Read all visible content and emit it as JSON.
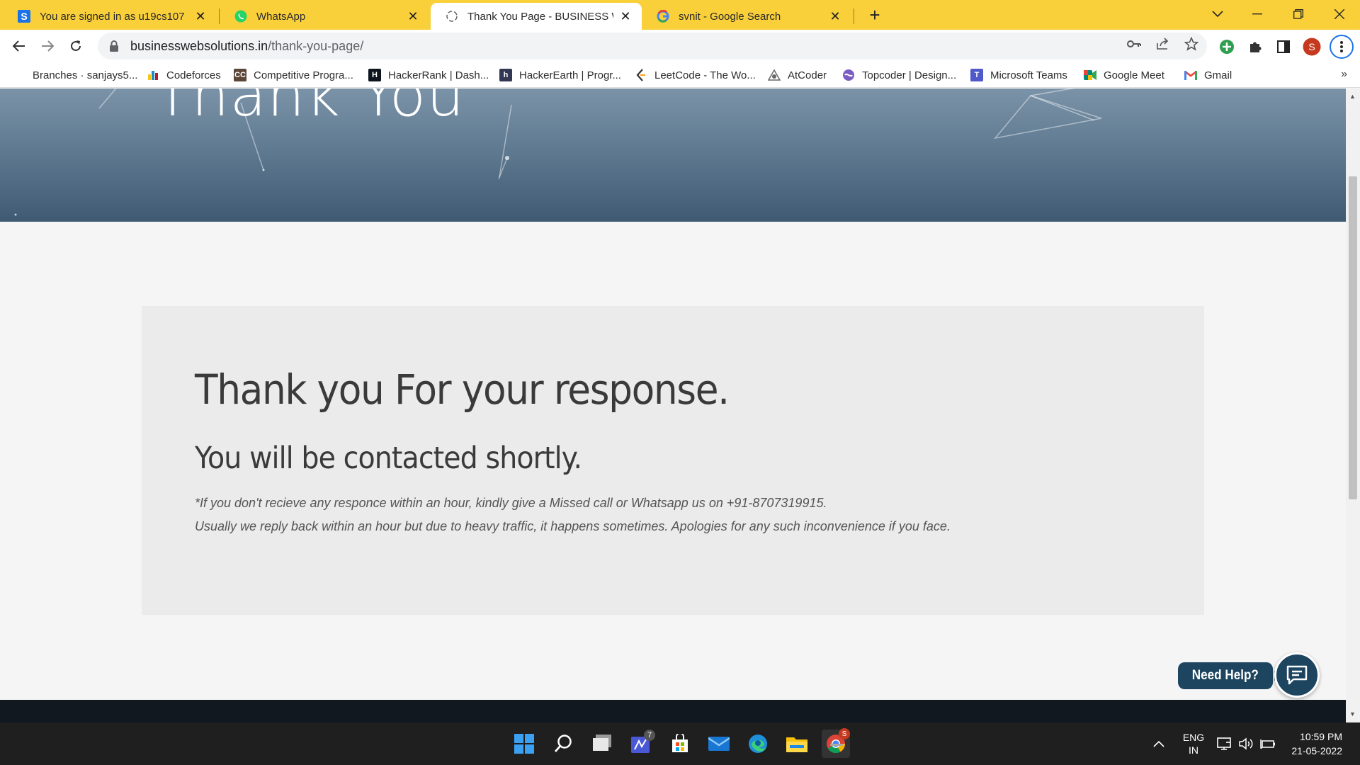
{
  "tabs": [
    {
      "title": "You are signed in as u19cs107",
      "favicon": "s-box-icon",
      "color": "#1a73e8"
    },
    {
      "title": "WhatsApp",
      "favicon": "whatsapp-icon",
      "color": "#25d366"
    },
    {
      "title": "Thank You Page - BUSINESS WEB",
      "favicon": "site-swirl-icon",
      "color": "#5f6368"
    },
    {
      "title": "svnit - Google Search",
      "favicon": "google-g-icon",
      "color": "#4285f4"
    }
  ],
  "address": {
    "host": "businesswebsolutions.in",
    "path": "/thank-you-page/"
  },
  "profile_initial": "S",
  "bookmarks": [
    {
      "label": "Branches · sanjays5...",
      "icon": "github-icon",
      "color": "#24292e"
    },
    {
      "label": "Codeforces",
      "icon": "codeforces-icon",
      "color": "#1f8acb"
    },
    {
      "label": "Competitive Progra...",
      "icon": "cc-icon",
      "color": "#5b4638"
    },
    {
      "label": "HackerRank | Dash...",
      "icon": "hackerrank-icon",
      "color": "#0e141e"
    },
    {
      "label": "HackerEarth | Progr...",
      "icon": "hackerearth-icon",
      "color": "#323754"
    },
    {
      "label": "LeetCode - The Wo...",
      "icon": "leetcode-icon",
      "color": "#ffa116"
    },
    {
      "label": "AtCoder",
      "icon": "atcoder-icon",
      "color": "#666666"
    },
    {
      "label": "Topcoder | Design...",
      "icon": "topcoder-icon",
      "color": "#7b5cc4"
    },
    {
      "label": "Microsoft Teams",
      "icon": "teams-icon",
      "color": "#5059c9"
    },
    {
      "label": "Google Meet",
      "icon": "meet-icon",
      "color": "#00897b"
    },
    {
      "label": "Gmail",
      "icon": "gmail-icon",
      "color": "#ea4335"
    }
  ],
  "hero": {
    "title": "Thank You"
  },
  "card": {
    "heading": "Thank you For your response.",
    "subheading": "You will be contacted shortly.",
    "note_line1": "*If you don't recieve any responce within an hour, kindly give a Missed call or Whatsapp us on +91-8707319915.",
    "note_line2": "Usually we reply back within an hour but due to heavy traffic, it happens sometimes. Apologies for any such inconvenience if you face."
  },
  "help": {
    "label": "Need Help?"
  },
  "taskbar": {
    "badge_count": "7",
    "chrome_badge": "S",
    "lang": "ENG",
    "region": "IN",
    "time": "10:59 PM",
    "date": "21-05-2022"
  }
}
